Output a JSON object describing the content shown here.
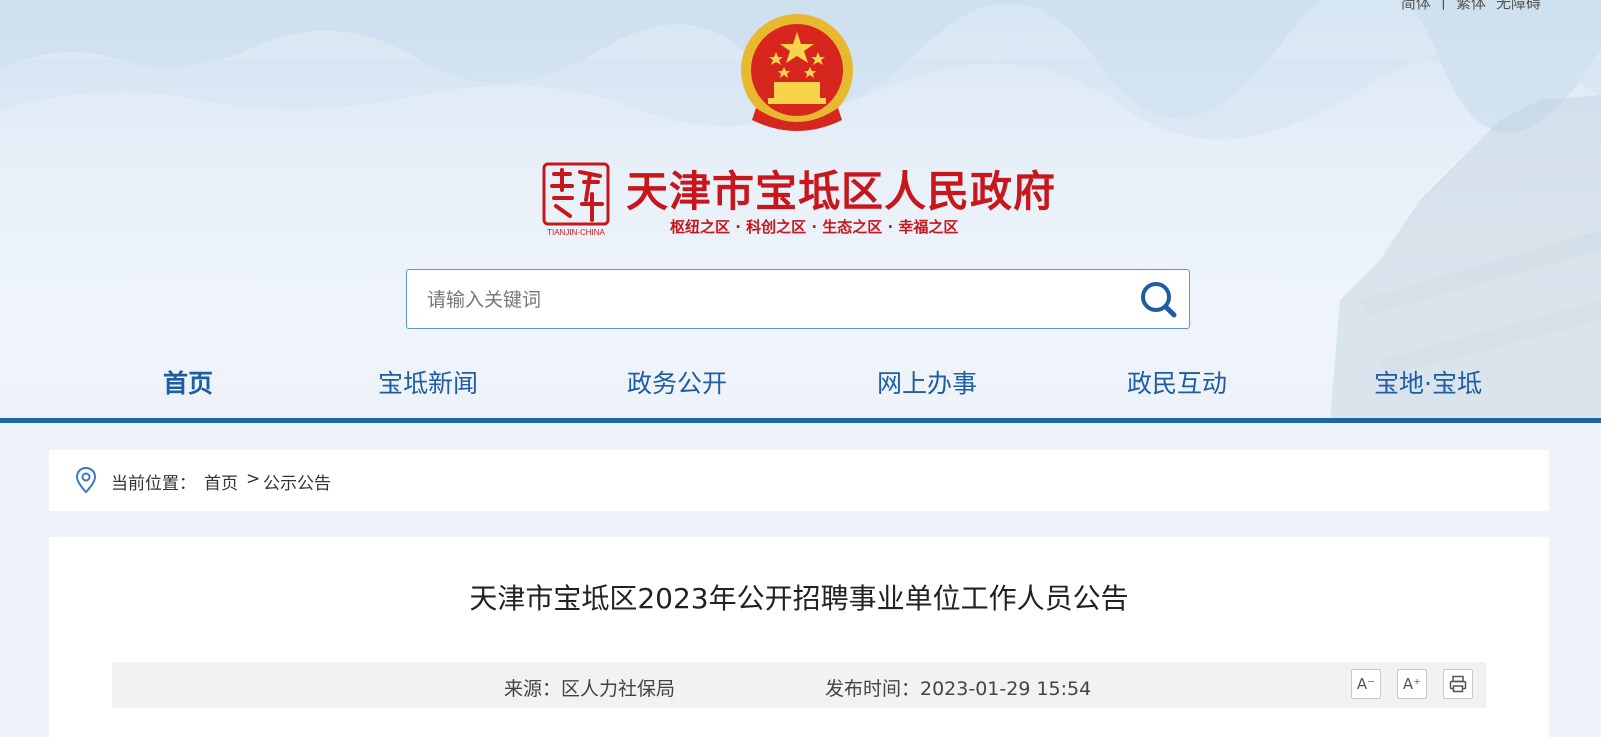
{
  "top_links": [
    "简体",
    "|",
    "繁体",
    "无障碍"
  ],
  "site": {
    "title": "天津市宝坻区人民政府",
    "slogan": "枢纽之区 · 科创之区 · 生态之区 · 幸福之区",
    "seal_text": "TIANJIN·CHINA"
  },
  "search": {
    "placeholder": "请输入关键词",
    "value": ""
  },
  "nav": {
    "items": [
      {
        "label": "首页",
        "active": true
      },
      {
        "label": "宝坻新闻",
        "active": false
      },
      {
        "label": "政务公开",
        "active": false
      },
      {
        "label": "网上办事",
        "active": false
      },
      {
        "label": "政民互动",
        "active": false
      },
      {
        "label": "宝地·宝坻",
        "active": false
      }
    ]
  },
  "breadcrumb": {
    "label": "当前位置：",
    "items": [
      "首页",
      ">",
      "公示公告"
    ]
  },
  "article": {
    "title": "天津市宝坻区2023年公开招聘事业单位工作人员公告",
    "source": "来源：区人力社保局",
    "publish_time": "发布时间：2023-01-29 15:54"
  },
  "tools": {
    "font_decrease": "A⁻",
    "font_increase": "A⁺"
  },
  "colors": {
    "brand_red": "#c8161d",
    "nav_blue": "#1f64a8"
  }
}
